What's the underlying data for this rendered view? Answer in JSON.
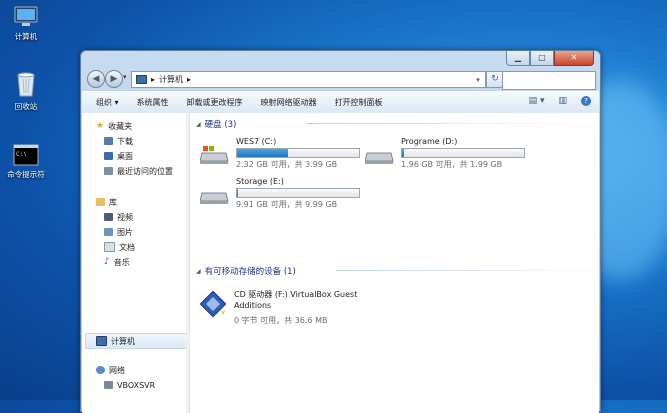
{
  "desktop": {
    "icons": [
      {
        "label": "计算机"
      },
      {
        "label": "回收站"
      },
      {
        "label": "命令提示符"
      }
    ]
  },
  "window": {
    "caption_buttons": {
      "minimize": "▁",
      "maximize": "▢",
      "close": "✕"
    },
    "nav": {
      "back": "◀",
      "forward": "▶",
      "history": "▾"
    },
    "address": {
      "path_root_sep": "▸",
      "path": "计算机",
      "path_sep": "▸",
      "dropdown": "▾"
    },
    "refresh": "↻",
    "search": {
      "placeholder": ""
    },
    "toolbar": {
      "items": [
        {
          "label": "组织 ▾"
        },
        {
          "label": "系统属性"
        },
        {
          "label": "卸载或更改程序"
        },
        {
          "label": "映射网络驱动器"
        },
        {
          "label": "打开控制面板"
        }
      ],
      "right": {
        "view": "▤ ▾",
        "preview": "▥",
        "help": "?"
      }
    },
    "nav_pane": {
      "favorites": {
        "label": "收藏夹",
        "items": [
          "下载",
          "桌面",
          "最近访问的位置"
        ]
      },
      "libraries": {
        "label": "库",
        "items": [
          "视频",
          "图片",
          "文档",
          "音乐"
        ]
      },
      "computer": {
        "label": "计算机"
      },
      "network": {
        "label": "网络",
        "items": [
          "VBOXSVR"
        ]
      }
    },
    "content": {
      "hard_disks": {
        "title": "硬盘 (3)",
        "drives": [
          {
            "name": "WES7 (C:)",
            "info": "2.32 GB 可用，共 3.99 GB",
            "used_fraction": 0.42
          },
          {
            "name": "Programe (D:)",
            "info": "1.96 GB 可用，共 1.99 GB",
            "used_fraction": 0.02
          },
          {
            "name": "Storage (E:)",
            "info": "9.91 GB 可用，共 9.99 GB",
            "used_fraction": 0.01
          }
        ]
      },
      "removable": {
        "title": "有可移动存储的设备 (1)",
        "devices": [
          {
            "name": "CD 驱动器 (F:) VirtualBox Guest Additions",
            "info": "0 字节 可用，共 36.6 MB"
          }
        ]
      }
    },
    "accent": "#2675c0"
  }
}
